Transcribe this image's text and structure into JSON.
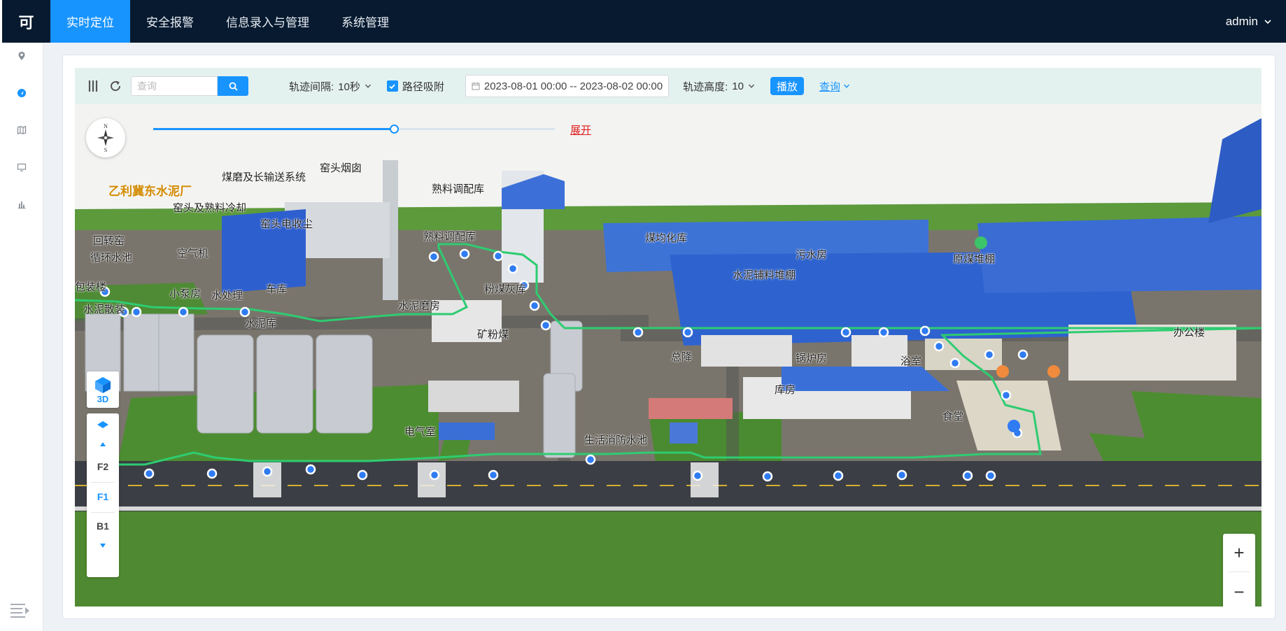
{
  "app": {
    "logo_char": "可",
    "user": "admin"
  },
  "nav": [
    {
      "label": "实时定位",
      "active": true
    },
    {
      "label": "安全报警",
      "active": false
    },
    {
      "label": "信息录入与管理",
      "active": false
    },
    {
      "label": "系统管理",
      "active": false
    }
  ],
  "sidebar": {
    "icons": [
      "location-pin-icon",
      "navigation-icon",
      "map-icon",
      "monitor-icon",
      "bar-chart-icon"
    ],
    "active_index": 1
  },
  "toolbar": {
    "search_placeholder": "查询",
    "interval_label": "轨迹间隔:",
    "interval_value": "10秒",
    "snap_label": "路径吸附",
    "snap_checked": true,
    "date_range": "2023-08-01 00:00 -- 2023-08-02 00:00",
    "height_label": "轨迹高度:",
    "height_value": "10",
    "play_label": "播放",
    "query_label": "查询"
  },
  "timeline": {
    "progress": 0.6,
    "expand_label": "展开"
  },
  "map": {
    "title": "冀东水泥厂",
    "title_prefix": "乙利",
    "compass_n": "N",
    "compass_s": "S",
    "labels": {
      "coal_conveyor": "煤磨及长输送系统",
      "kiln_chimney": "窑头烟囱",
      "raw_blend": "熟料调配库",
      "kiln_cooler": "窑头及熟料冷却",
      "kiln_dust": "窑头电收尘",
      "rotary_kiln": "回转窑",
      "water_pool": "循环水池",
      "air_compressor": "空气机",
      "clinker_blend": "熟料调配库",
      "coal_homo": "煤均化库",
      "sewage": "污水房",
      "raw_coal": "原煤堆棚",
      "cement_aux": "水泥辅料堆棚",
      "fly_ash": "粉煤灰库",
      "packing_bldg": "包装楼",
      "small_pump": "小泵房",
      "water_treat": "水处理",
      "garage": "车库",
      "cement_mill": "水泥磨房",
      "cement_bulk": "水泥散装",
      "cement_silo": "水泥库",
      "mineral_powder": "矿粉煤",
      "main_control": "总降",
      "boiler": "锅炉房",
      "bathroom": "浴室",
      "office": "办公楼",
      "warehouse": "库房",
      "canteen": "食堂",
      "electric": "电气室",
      "fire_pool": "生活消防水池"
    }
  },
  "floors": {
    "view_label": "3D",
    "items": [
      "F2",
      "F1",
      "B1"
    ],
    "active": "F1"
  },
  "zoom": {
    "in": "+",
    "out": "−"
  }
}
